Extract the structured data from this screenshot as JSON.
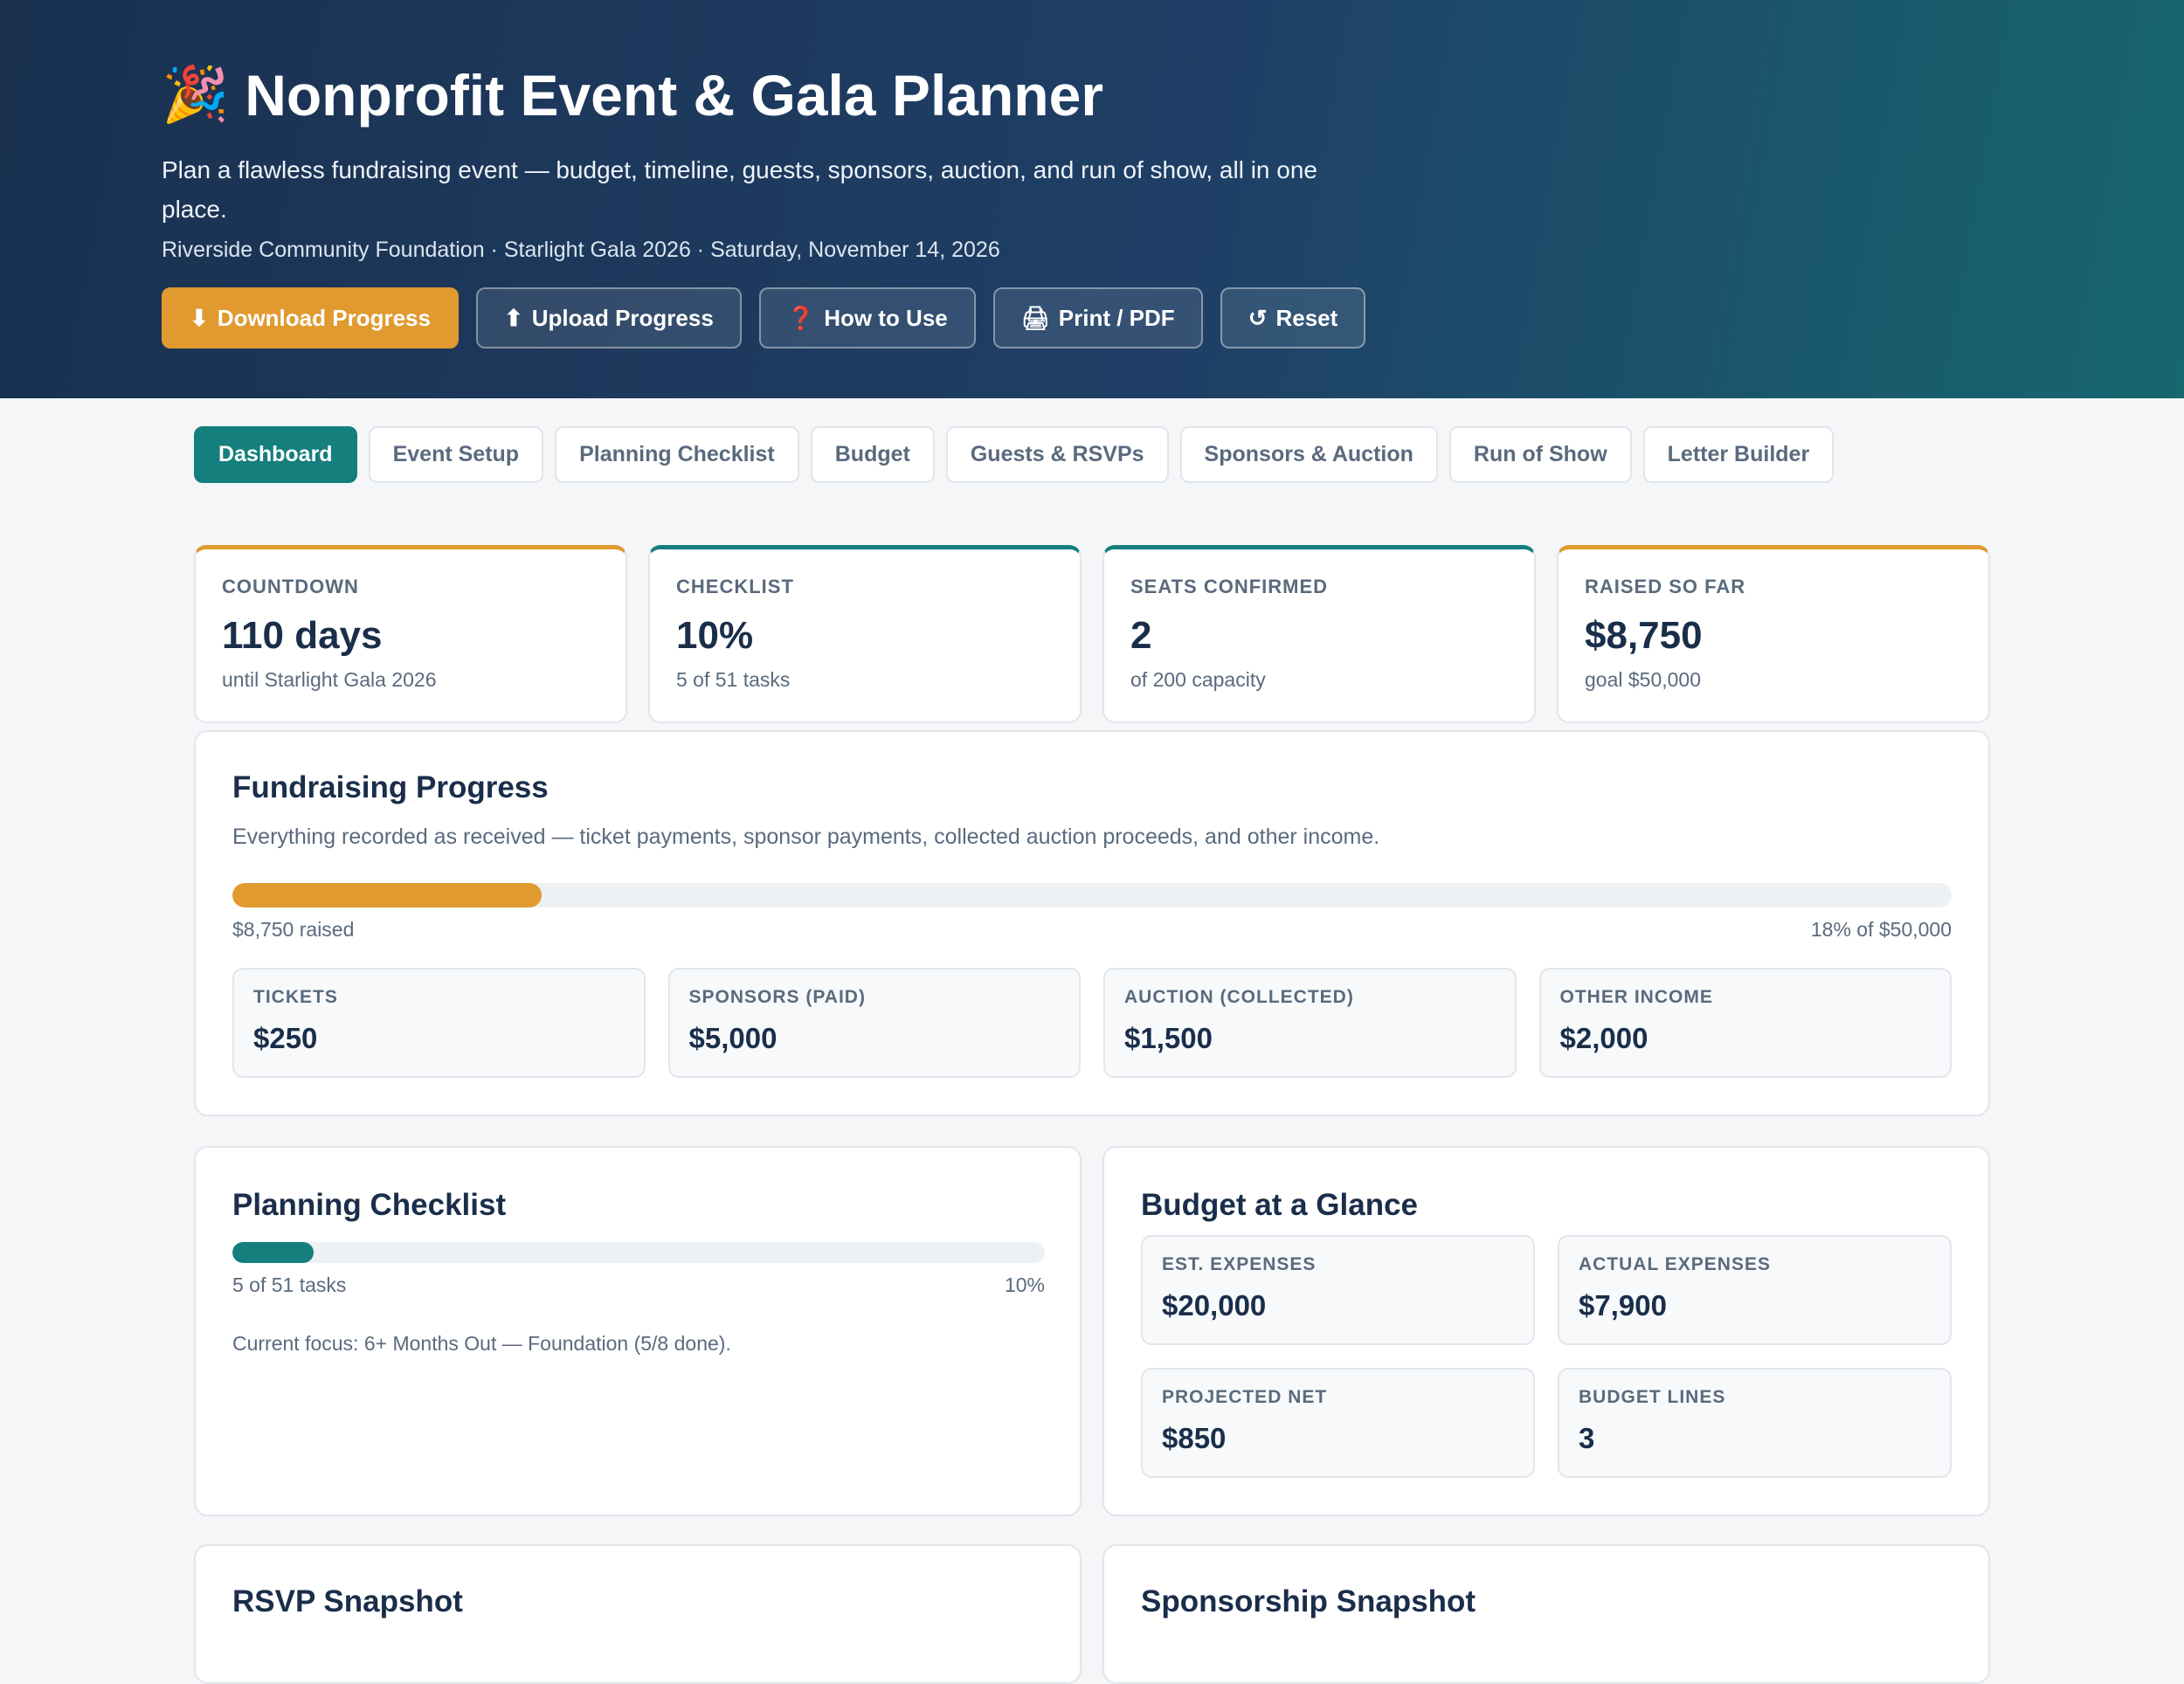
{
  "header": {
    "emoji": "🎉",
    "title": "Nonprofit Event & Gala Planner",
    "subtitle": "Plan a flawless fundraising event — budget, timeline, guests, sponsors, auction, and run of show, all in one place.",
    "meta": "Riverside Community Foundation · Starlight Gala 2026 · Saturday, November 14, 2026",
    "actions": [
      {
        "icon": "⬇",
        "label": "Download Progress"
      },
      {
        "icon": "⬆",
        "label": "Upload Progress"
      },
      {
        "icon": "❓",
        "label": "How to Use"
      },
      {
        "icon": "🖨",
        "label": "Print / PDF"
      },
      {
        "icon": "↺",
        "label": "Reset"
      }
    ]
  },
  "tabs": [
    "Dashboard",
    "Event Setup",
    "Planning Checklist",
    "Budget",
    "Guests & RSVPs",
    "Sponsors & Auction",
    "Run of Show",
    "Letter Builder"
  ],
  "active_tab": "Dashboard",
  "stats": [
    {
      "label": "COUNTDOWN",
      "value": "110 days",
      "sub": "until Starlight Gala 2026"
    },
    {
      "label": "CHECKLIST",
      "value": "10%",
      "sub": "5 of 51 tasks"
    },
    {
      "label": "SEATS CONFIRMED",
      "value": "2",
      "sub": "of 200 capacity"
    },
    {
      "label": "RAISED SO FAR",
      "value": "$8,750",
      "sub": "goal $50,000"
    }
  ],
  "fundraising": {
    "title": "Fundraising Progress",
    "description": "Everything recorded as received — ticket payments, sponsor payments, collected auction proceeds, and other income.",
    "progress_fraction": 0.18,
    "raised_label": "$8,750 raised",
    "percent_label": "18% of $50,000",
    "breakdown": [
      {
        "label": "TICKETS",
        "value": "$250"
      },
      {
        "label": "SPONSORS (PAID)",
        "value": "$5,000"
      },
      {
        "label": "AUCTION (COLLECTED)",
        "value": "$1,500"
      },
      {
        "label": "OTHER INCOME",
        "value": "$2,000"
      }
    ]
  },
  "checklist": {
    "title": "Planning Checklist",
    "progress_fraction": 0.1,
    "tasks_label": "5 of 51 tasks",
    "percent_label": "10%",
    "focus": "Current focus: 6+ Months Out — Foundation (5/8 done)."
  },
  "budget": {
    "title": "Budget at a Glance",
    "items": [
      {
        "label": "EST. EXPENSES",
        "value": "$20,000"
      },
      {
        "label": "ACTUAL EXPENSES",
        "value": "$7,900"
      },
      {
        "label": "PROJECTED NET",
        "value": "$850"
      },
      {
        "label": "BUDGET LINES",
        "value": "3"
      }
    ]
  },
  "rsvp": {
    "title": "RSVP Snapshot"
  },
  "sponsorship": {
    "title": "Sponsorship Snapshot"
  },
  "colors": {
    "accent_gold": "#e09a2f",
    "accent_teal": "#157f7d",
    "header_dark": "#1a3150"
  }
}
